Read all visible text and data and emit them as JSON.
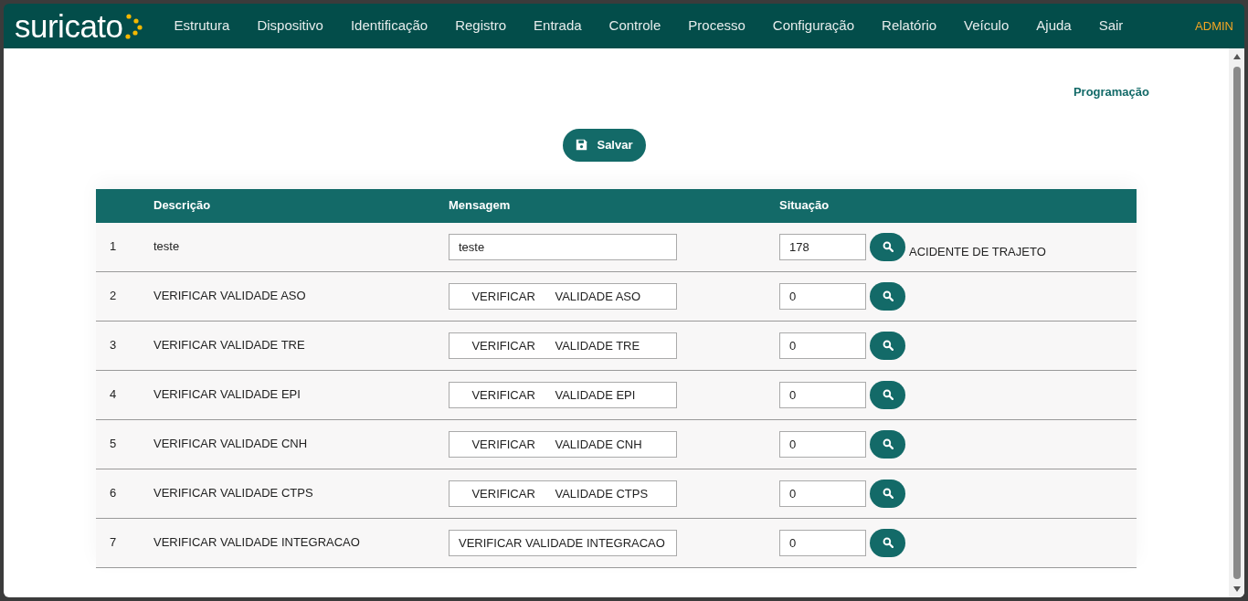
{
  "header": {
    "logo": "suricato",
    "menu": [
      "Estrutura",
      "Dispositivo",
      "Identificação",
      "Registro",
      "Entrada",
      "Controle",
      "Processo",
      "Configuração",
      "Relatório",
      "Veículo",
      "Ajuda",
      "Sair"
    ],
    "user": "ADMIN"
  },
  "page_title": "Programação",
  "save_button": "Salvar",
  "table": {
    "columns": [
      "Descrição",
      "Mensagem",
      "Situação"
    ],
    "rows": [
      {
        "number": "1",
        "description": "teste",
        "message": "teste",
        "situation": "178",
        "situation_label": "ACIDENTE DE TRAJETO"
      },
      {
        "number": "2",
        "description": "VERIFICAR VALIDADE ASO",
        "message": "    VERIFICAR      VALIDADE ASO",
        "situation": "0"
      },
      {
        "number": "3",
        "description": "VERIFICAR VALIDADE TRE",
        "message": "    VERIFICAR      VALIDADE TRE",
        "situation": "0"
      },
      {
        "number": "4",
        "description": "VERIFICAR VALIDADE EPI",
        "message": "    VERIFICAR      VALIDADE EPI",
        "situation": "0"
      },
      {
        "number": "5",
        "description": "VERIFICAR VALIDADE CNH",
        "message": "    VERIFICAR      VALIDADE CNH",
        "situation": "0"
      },
      {
        "number": "6",
        "description": "VERIFICAR VALIDADE CTPS",
        "message": "    VERIFICAR      VALIDADE CTPS",
        "situation": "0"
      },
      {
        "number": "7",
        "description": "VERIFICAR VALIDADE INTEGRACAO",
        "message": "VERIFICAR VALIDADE INTEGRACAO",
        "situation": "0"
      }
    ]
  }
}
